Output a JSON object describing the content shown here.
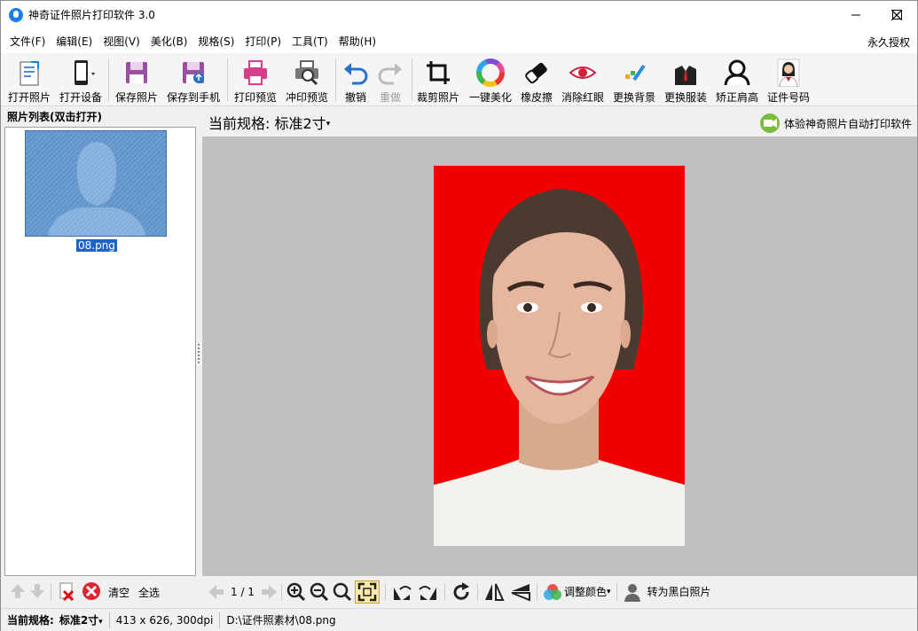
{
  "window": {
    "title": "神奇证件照片打印软件 3.0"
  },
  "menu": {
    "items": [
      "文件(F)",
      "编辑(E)",
      "视图(V)",
      "美化(B)",
      "规格(S)",
      "打印(P)",
      "工具(T)",
      "帮助(H)"
    ],
    "license": "永久授权"
  },
  "toolbar": {
    "open_photo": "打开照片",
    "open_device": "打开设备",
    "save_photo": "保存照片",
    "save_to_phone": "保存到手机",
    "print_preview": "打印预览",
    "develop_preview": "冲印预览",
    "undo": "撤销",
    "redo": "重做",
    "crop": "裁剪照片",
    "beautify": "一键美化",
    "eraser": "橡皮擦",
    "red_eye": "消除红眼",
    "change_bg": "更换背景",
    "change_clothes": "更换服装",
    "correct_shoulder": "矫正肩高",
    "id_number": "证件号码"
  },
  "left_panel": {
    "title": "照片列表(双击打开)",
    "files": [
      {
        "name": "08.png"
      }
    ],
    "clear": "清空",
    "select_all": "全选"
  },
  "main": {
    "spec_prefix": "当前规格:",
    "spec_value": "标准2寸",
    "promo": "体验神奇照片自动打印软件",
    "page": "1 / 1",
    "adjust_color": "调整颜色",
    "to_bw": "转为黑白照片",
    "background_color": "#f20000"
  },
  "status": {
    "spec_prefix": "当前规格:",
    "spec_value": "标准2寸",
    "dims": "413 x 626, 300dpi",
    "path": "D:\\证件照素材\\08.png"
  }
}
